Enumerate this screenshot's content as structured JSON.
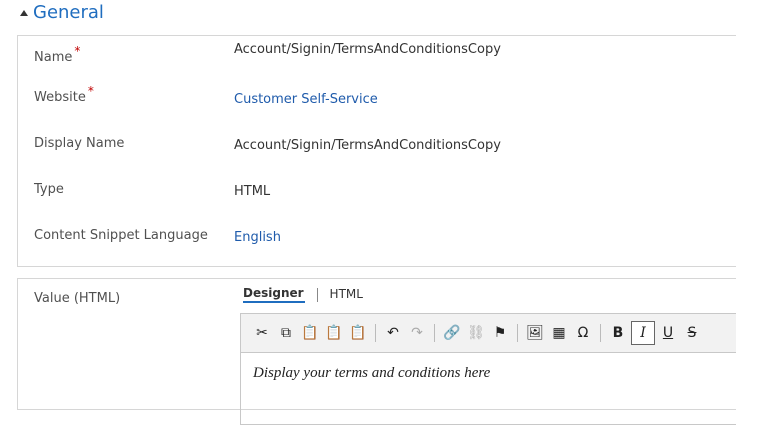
{
  "section": {
    "title": "General"
  },
  "fields": [
    {
      "label": "Name",
      "required": "*",
      "value": "Account/Signin/TermsAndConditionsCopy"
    },
    {
      "label": "Website",
      "required": "*",
      "value": "Customer Self-Service"
    },
    {
      "label": "Display Name",
      "value": "Account/Signin/TermsAndConditionsCopy"
    },
    {
      "label": "Type",
      "value": "HTML"
    },
    {
      "label": "Content Snippet Language",
      "value": "English"
    }
  ],
  "value_field": {
    "label": "Value (HTML)",
    "tabs": [
      "Designer",
      "HTML"
    ],
    "active_tab": "Designer",
    "content": "Display your terms and conditions here"
  },
  "toolbar_icons": {
    "cut": "✂",
    "copy": "⧉",
    "paste": "📋",
    "paste_text": "📋",
    "paste_word": "📋",
    "undo": "↶",
    "redo": "↷",
    "link": "🔗",
    "unlink": "⛓",
    "anchor": "⚑",
    "image": "🖼",
    "table": "▦",
    "special_char": "Ω",
    "bold": "B",
    "italic": "I",
    "underline": "U",
    "strike": "S"
  },
  "colors": {
    "accent": "#1f6dbf",
    "link": "#1f5bab",
    "required": "#c00000"
  }
}
